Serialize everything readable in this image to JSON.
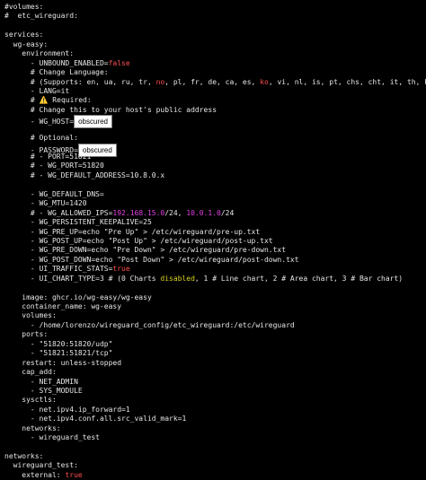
{
  "terminal": {
    "lines": [
      [
        [
          "#volumes:",
          ""
        ]
      ],
      [
        [
          "#  etc_wireguard:",
          ""
        ]
      ],
      [
        [
          "",
          ""
        ]
      ],
      [
        [
          "services:",
          ""
        ]
      ],
      [
        [
          "  wg-easy:",
          ""
        ]
      ],
      [
        [
          "    environment:",
          ""
        ]
      ],
      [
        [
          "      - UNBOUND_ENABLED=",
          ""
        ],
        [
          "false",
          "red"
        ]
      ],
      [
        [
          "      # Change Language:",
          ""
        ]
      ],
      [
        [
          "      # (Supports: en, ua, ru, tr, ",
          ""
        ],
        [
          "no",
          "red"
        ],
        [
          ", pl, fr, de, ca, es, ",
          ""
        ],
        [
          "ko",
          "red"
        ],
        [
          ", vi, nl, is, pt, chs, cht, it, th, hi",
          ""
        ]
      ],
      [
        [
          "      - LANG=it",
          ""
        ]
      ],
      [
        [
          "      # ⚠️ Required:",
          ""
        ]
      ],
      [
        [
          "      # Change this to your host's public address",
          ""
        ]
      ],
      [
        [
          "      - WG_HOST=",
          ""
        ],
        [
          "obscured",
          "obscured"
        ]
      ],
      [
        [
          "",
          ""
        ]
      ],
      [
        [
          "      # Optional:",
          ""
        ]
      ],
      [
        [
          "      - PASSWORD=",
          ""
        ],
        [
          "obscured",
          "obscured"
        ]
      ],
      [
        [
          "      # - PORT=51821",
          ""
        ]
      ],
      [
        [
          "      # - WG_PORT=51820",
          ""
        ]
      ],
      [
        [
          "      # - WG_DEFAULT_ADDRESS=10.8.0.x",
          ""
        ]
      ],
      [
        [
          "",
          ""
        ]
      ],
      [
        [
          "      - WG_DEFAULT_DNS=",
          ""
        ]
      ],
      [
        [
          "      - WG_MTU=1420",
          ""
        ]
      ],
      [
        [
          "      # - WG_ALLOWED_IPS=",
          ""
        ],
        [
          "192.168.15.0",
          "magenta"
        ],
        [
          "/24, ",
          ""
        ],
        [
          "10.0.1.0",
          "magenta"
        ],
        [
          "/24",
          ""
        ]
      ],
      [
        [
          "      - WG_PERSISTENT_KEEPALIVE=25",
          ""
        ]
      ],
      [
        [
          "      - WG_PRE_UP=echo \"Pre Up\" > /etc/wireguard/pre-up.txt",
          ""
        ]
      ],
      [
        [
          "      - WG_POST_UP=echo \"Post Up\" > /etc/wireguard/post-up.txt",
          ""
        ]
      ],
      [
        [
          "      - WG_PRE_DOWN=echo \"Pre Down\" > /etc/wireguard/pre-down.txt",
          ""
        ]
      ],
      [
        [
          "      - WG_POST_DOWN=echo \"Post Down\" > /etc/wireguard/post-down.txt",
          ""
        ]
      ],
      [
        [
          "      - UI_TRAFFIC_STATS=",
          ""
        ],
        [
          "true",
          "red"
        ]
      ],
      [
        [
          "      - UI_CHART_TYPE=3 # (0 Charts ",
          ""
        ],
        [
          "disabled",
          "yellow"
        ],
        [
          ", 1 # Line chart, 2 # Area chart, 3 # Bar chart)",
          ""
        ]
      ],
      [
        [
          "",
          ""
        ]
      ],
      [
        [
          "    image: ghcr.io/wg-easy/wg-easy",
          ""
        ]
      ],
      [
        [
          "    container_name: wg-easy",
          ""
        ]
      ],
      [
        [
          "    volumes:",
          ""
        ]
      ],
      [
        [
          "      - /home/lorenzo/wireguard_config/etc_wireguard:/etc/wireguard",
          ""
        ]
      ],
      [
        [
          "    ports:",
          ""
        ]
      ],
      [
        [
          "      - \"51820:51820/udp\"",
          ""
        ]
      ],
      [
        [
          "      - \"51821:51821/tcp\"",
          ""
        ]
      ],
      [
        [
          "    restart: unless-stopped",
          ""
        ]
      ],
      [
        [
          "    cap_add:",
          ""
        ]
      ],
      [
        [
          "      - NET_ADMIN",
          ""
        ]
      ],
      [
        [
          "      - SYS_MODULE",
          ""
        ]
      ],
      [
        [
          "    sysctls:",
          ""
        ]
      ],
      [
        [
          "      - net.ipv4.ip_forward=1",
          ""
        ]
      ],
      [
        [
          "      - net.ipv4.conf.all.src_valid_mark=1",
          ""
        ]
      ],
      [
        [
          "    networks:",
          ""
        ]
      ],
      [
        [
          "      - wireguard_test",
          ""
        ]
      ],
      [
        [
          "",
          ""
        ]
      ],
      [
        [
          "networks:",
          ""
        ]
      ],
      [
        [
          "  wireguard_test:",
          ""
        ]
      ],
      [
        [
          "    external: ",
          ""
        ],
        [
          "true",
          "red"
        ]
      ]
    ]
  },
  "colors": {
    "background": "#000000",
    "text": "#e6e6e6",
    "red": "#ff4d4d",
    "magenta": "#e23ee2",
    "yellow": "#d8d020",
    "obscured_box": "#ffffff"
  }
}
